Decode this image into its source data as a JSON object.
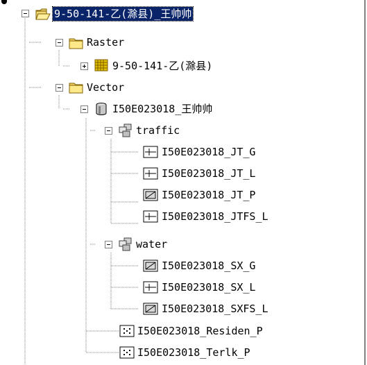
{
  "tree": {
    "root": {
      "label": "9-50-141-乙(滁县)_王帅帅",
      "icon": "open-folder-icon",
      "expanded": true,
      "selected": true
    },
    "raster_folder": {
      "label": "Raster",
      "icon": "folder-icon",
      "expanded": true
    },
    "raster_dataset": {
      "label": "9-50-141-乙(滁县)",
      "icon": "raster-grid-icon",
      "expanded": false
    },
    "vector_folder": {
      "label": "Vector",
      "icon": "folder-icon",
      "expanded": true
    },
    "geodatabase": {
      "label": "I50E023018_王帅帅",
      "icon": "database-icon",
      "expanded": true
    },
    "dataset_traffic": {
      "label": "traffic",
      "icon": "feature-dataset-icon",
      "expanded": true
    },
    "traffic_items": [
      {
        "label": "I50E023018_JT_G",
        "icon": "line-feature-icon"
      },
      {
        "label": "I50E023018_JT_L",
        "icon": "line-feature-icon"
      },
      {
        "label": "I50E023018_JT_P",
        "icon": "polygon-feature-icon"
      },
      {
        "label": "I50E023018_JTFS_L",
        "icon": "line-feature-icon"
      }
    ],
    "dataset_water": {
      "label": "water",
      "icon": "feature-dataset-icon",
      "expanded": true
    },
    "water_items": [
      {
        "label": "I50E023018_SX_G",
        "icon": "polygon-feature-icon"
      },
      {
        "label": "I50E023018_SX_L",
        "icon": "line-feature-icon"
      },
      {
        "label": "I50E023018_SXFS_L",
        "icon": "polygon-feature-icon"
      }
    ],
    "point_items": [
      {
        "label": "I50E023018_Residen_P",
        "icon": "point-feature-icon"
      },
      {
        "label": "I50E023018_Terlk_P",
        "icon": "point-feature-icon"
      }
    ]
  }
}
